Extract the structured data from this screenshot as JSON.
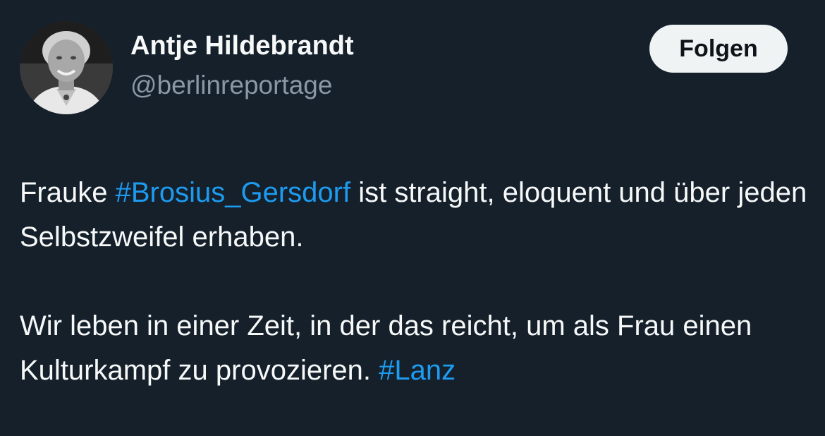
{
  "author": {
    "display_name": "Antje Hildebrandt",
    "handle": "@berlinreportage"
  },
  "follow_button": {
    "label": "Folgen"
  },
  "colors": {
    "background": "#15202b",
    "text": "#f7f9f9",
    "secondary_text": "#8b98a5",
    "link": "#1d9bf0",
    "button_bg": "#eff3f4"
  },
  "tweet": {
    "p1_a": "Frauke ",
    "hashtag1": "#Brosius_Gersdorf",
    "p1_b": " ist straight, eloquent und über jeden Selbstzweifel erhaben.",
    "p2_a": "Wir leben in einer Zeit, in der das reicht, um als Frau einen Kulturkampf zu provozieren. ",
    "hashtag2": "#Lanz"
  }
}
